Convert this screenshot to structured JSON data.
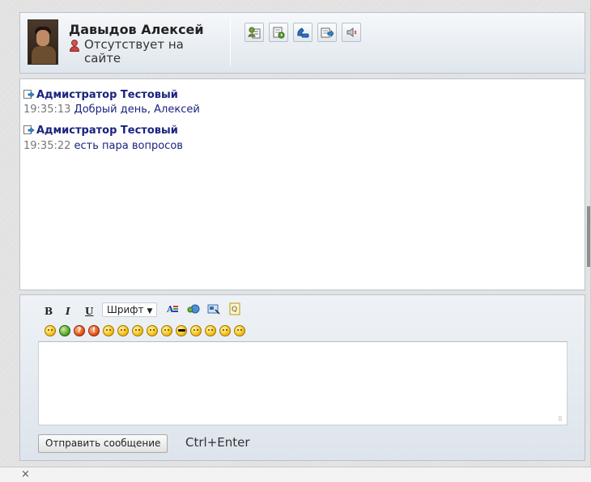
{
  "header": {
    "user_name": "Давыдов Алексей",
    "status_text": "Отсутствует на сайте",
    "status_icon": "user-offline-icon",
    "toolbar_icons": [
      "user-card-icon",
      "history-icon",
      "call-icon",
      "transfer-icon",
      "sound-icon"
    ]
  },
  "messages": [
    {
      "author": "Адмистратор Тестовый",
      "time": "19:35:13",
      "text": "Добрый день, Алексей"
    },
    {
      "author": "Адмистратор Тестовый",
      "time": "19:35:22",
      "text": "есть пара вопросов"
    }
  ],
  "composer": {
    "bold_label": "B",
    "italic_label": "I",
    "underline_label": "U",
    "font_select_value": "Шрифт",
    "toolbar_icons": [
      "font-color-icon",
      "image-icon",
      "screenshot-icon",
      "quote-icon"
    ],
    "emoticons": [
      "laugh",
      "shield",
      "question",
      "exclamation",
      "smile",
      "sad",
      "frown",
      "crying",
      "tongue",
      "cool",
      "grimace",
      "neutral",
      "happy",
      "wink"
    ],
    "message_value": "",
    "send_button_label": "Отправить сообщение",
    "hotkey_hint": "Ctrl+Enter"
  },
  "footer": {
    "close_label": "×"
  },
  "colors": {
    "author": "#1a237e",
    "time": "#777777",
    "panel_border": "#b9c3cc"
  }
}
